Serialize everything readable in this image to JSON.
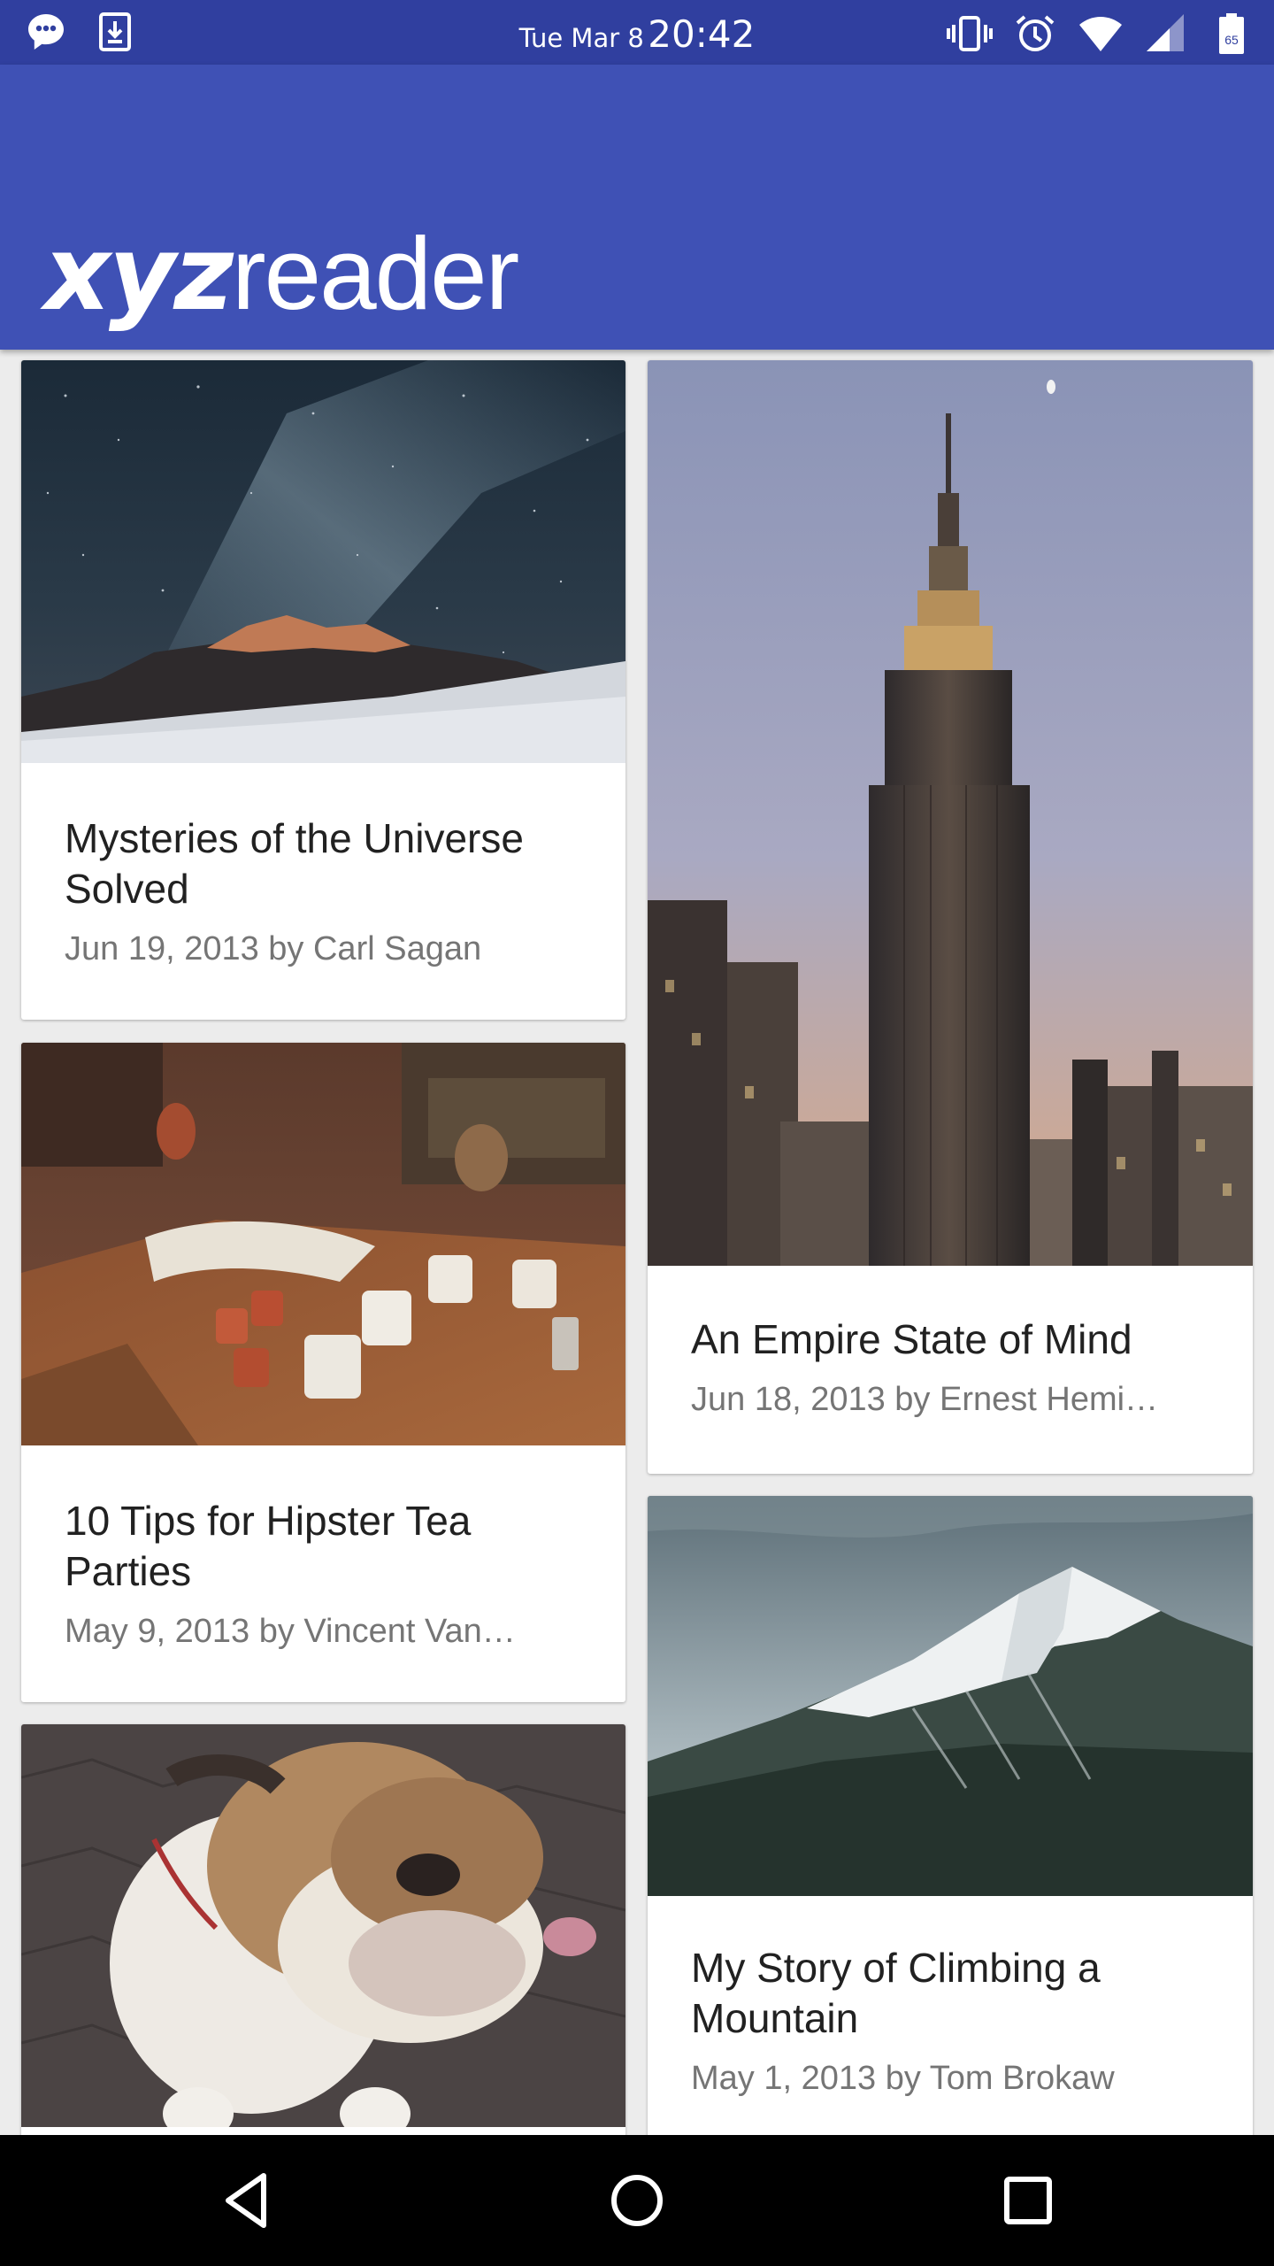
{
  "status_bar": {
    "date": "Tue Mar 8",
    "time": "20:42",
    "battery": "65",
    "icons": [
      "messenger-icon",
      "download-icon",
      "vibrate-icon",
      "alarm-icon",
      "wifi-icon",
      "signal-icon",
      "battery-icon"
    ]
  },
  "app_bar": {
    "logo_bold": "xyz",
    "logo_light": "reader",
    "background": "#3f51b5",
    "status_background": "#303f9f"
  },
  "articles": [
    {
      "title": "Mysteries of the Universe Solved",
      "subtitle": "Jun 19, 2013 by Carl Sagan",
      "image": "starry-sky-mountain-photo"
    },
    {
      "title": "An Empire State of Mind",
      "subtitle": "Jun 18, 2013 by Ernest Hemi…",
      "image": "empire-state-building-photo"
    },
    {
      "title": "10 Tips for Hipster Tea Parties",
      "subtitle": "May 9, 2013 by Vincent Van…",
      "image": "tea-cups-table-photo"
    },
    {
      "title": "My Story of Climbing a Mountain",
      "subtitle": "May 1, 2013 by Tom Brokaw",
      "image": "snowy-mountain-photo"
    },
    {
      "title": "",
      "subtitle": "",
      "image": "bulldog-photo"
    }
  ],
  "nav_bar": {
    "icons": [
      "back-icon",
      "home-icon",
      "recents-icon"
    ]
  }
}
